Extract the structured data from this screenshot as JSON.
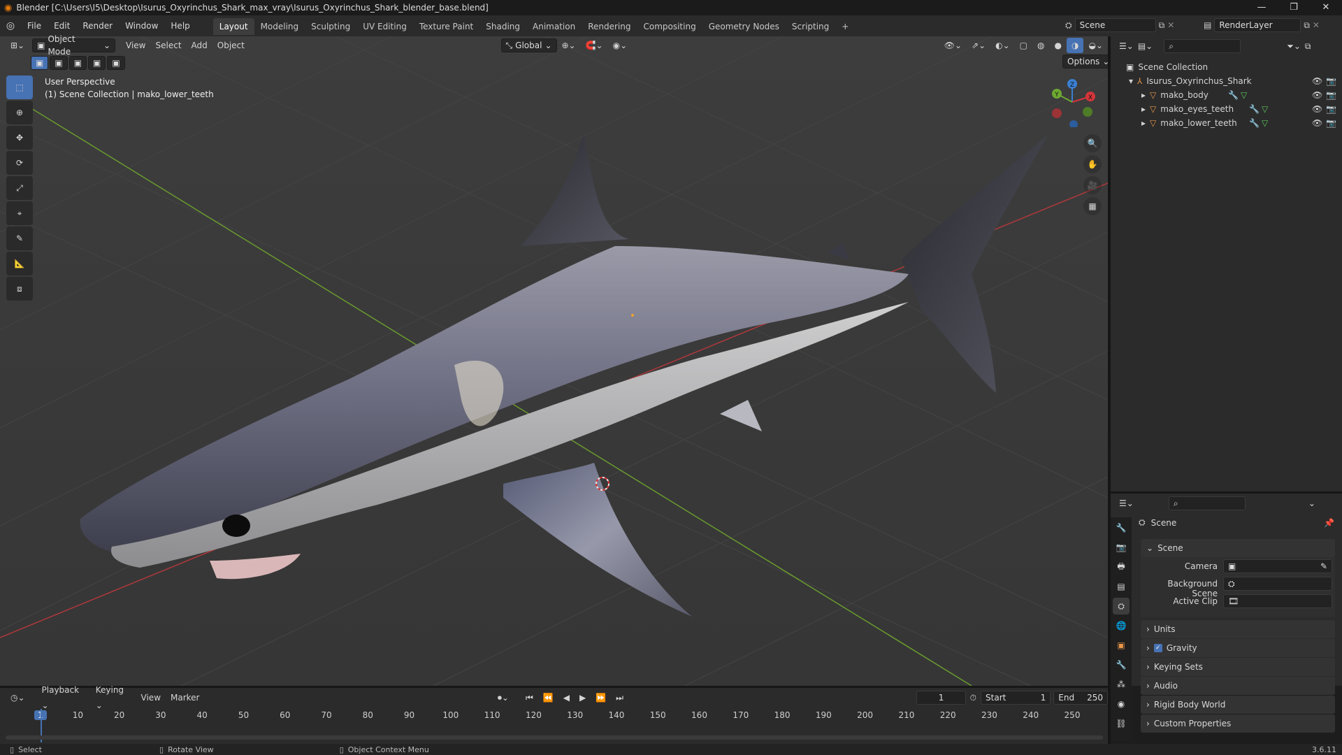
{
  "window": {
    "title": "Blender [C:\\Users\\I5\\Desktop\\Isurus_Oxyrinchus_Shark_max_vray\\Isurus_Oxyrinchus_Shark_blender_base.blend]"
  },
  "menu": [
    "File",
    "Edit",
    "Render",
    "Window",
    "Help"
  ],
  "workspaces": [
    "Layout",
    "Modeling",
    "Sculpting",
    "UV Editing",
    "Texture Paint",
    "Shading",
    "Animation",
    "Rendering",
    "Compositing",
    "Geometry Nodes",
    "Scripting"
  ],
  "active_workspace": "Layout",
  "top_right": {
    "scene": "Scene",
    "view_layer": "RenderLayer"
  },
  "viewport": {
    "mode": "Object Mode",
    "menus": [
      "View",
      "Select",
      "Add",
      "Object"
    ],
    "transform_orientation": "Global",
    "options_label": "Options",
    "overlay_title": "User Perspective",
    "overlay_subtitle": "(1) Scene Collection | mako_lower_teeth",
    "gizmo_labels": {
      "z": "Z",
      "y": "Y",
      "x": "X"
    }
  },
  "outliner": {
    "root": "Scene Collection",
    "collection": "Isurus_Oxyrinchus_Shark",
    "objects": [
      "mako_body",
      "mako_eyes_teeth",
      "mako_lower_teeth"
    ]
  },
  "properties": {
    "header": "Scene",
    "section": "Scene",
    "fields": {
      "camera": "Camera",
      "background_scene": "Background Scene",
      "active_clip": "Active Clip"
    },
    "panels": [
      "Units",
      "Gravity",
      "Keying Sets",
      "Audio",
      "Rigid Body World",
      "Custom Properties"
    ],
    "gravity_checked": true
  },
  "timeline": {
    "menus": [
      "Playback",
      "Keying",
      "View",
      "Marker"
    ],
    "current_frame": "1",
    "start_label": "Start",
    "start": "1",
    "end_label": "End",
    "end": "250",
    "ticks": [
      "1",
      "10",
      "20",
      "30",
      "40",
      "50",
      "60",
      "70",
      "80",
      "90",
      "100",
      "110",
      "120",
      "130",
      "140",
      "150",
      "160",
      "170",
      "180",
      "190",
      "200",
      "210",
      "220",
      "230",
      "240",
      "250"
    ]
  },
  "statusbar": {
    "select": "Select",
    "rotate": "Rotate View",
    "context": "Object Context Menu",
    "version": "3.6.11"
  },
  "colors": {
    "accent": "#4772b3",
    "x_axis": "#d4353a",
    "y_axis": "#6da831",
    "z_axis": "#3a7fd1"
  }
}
